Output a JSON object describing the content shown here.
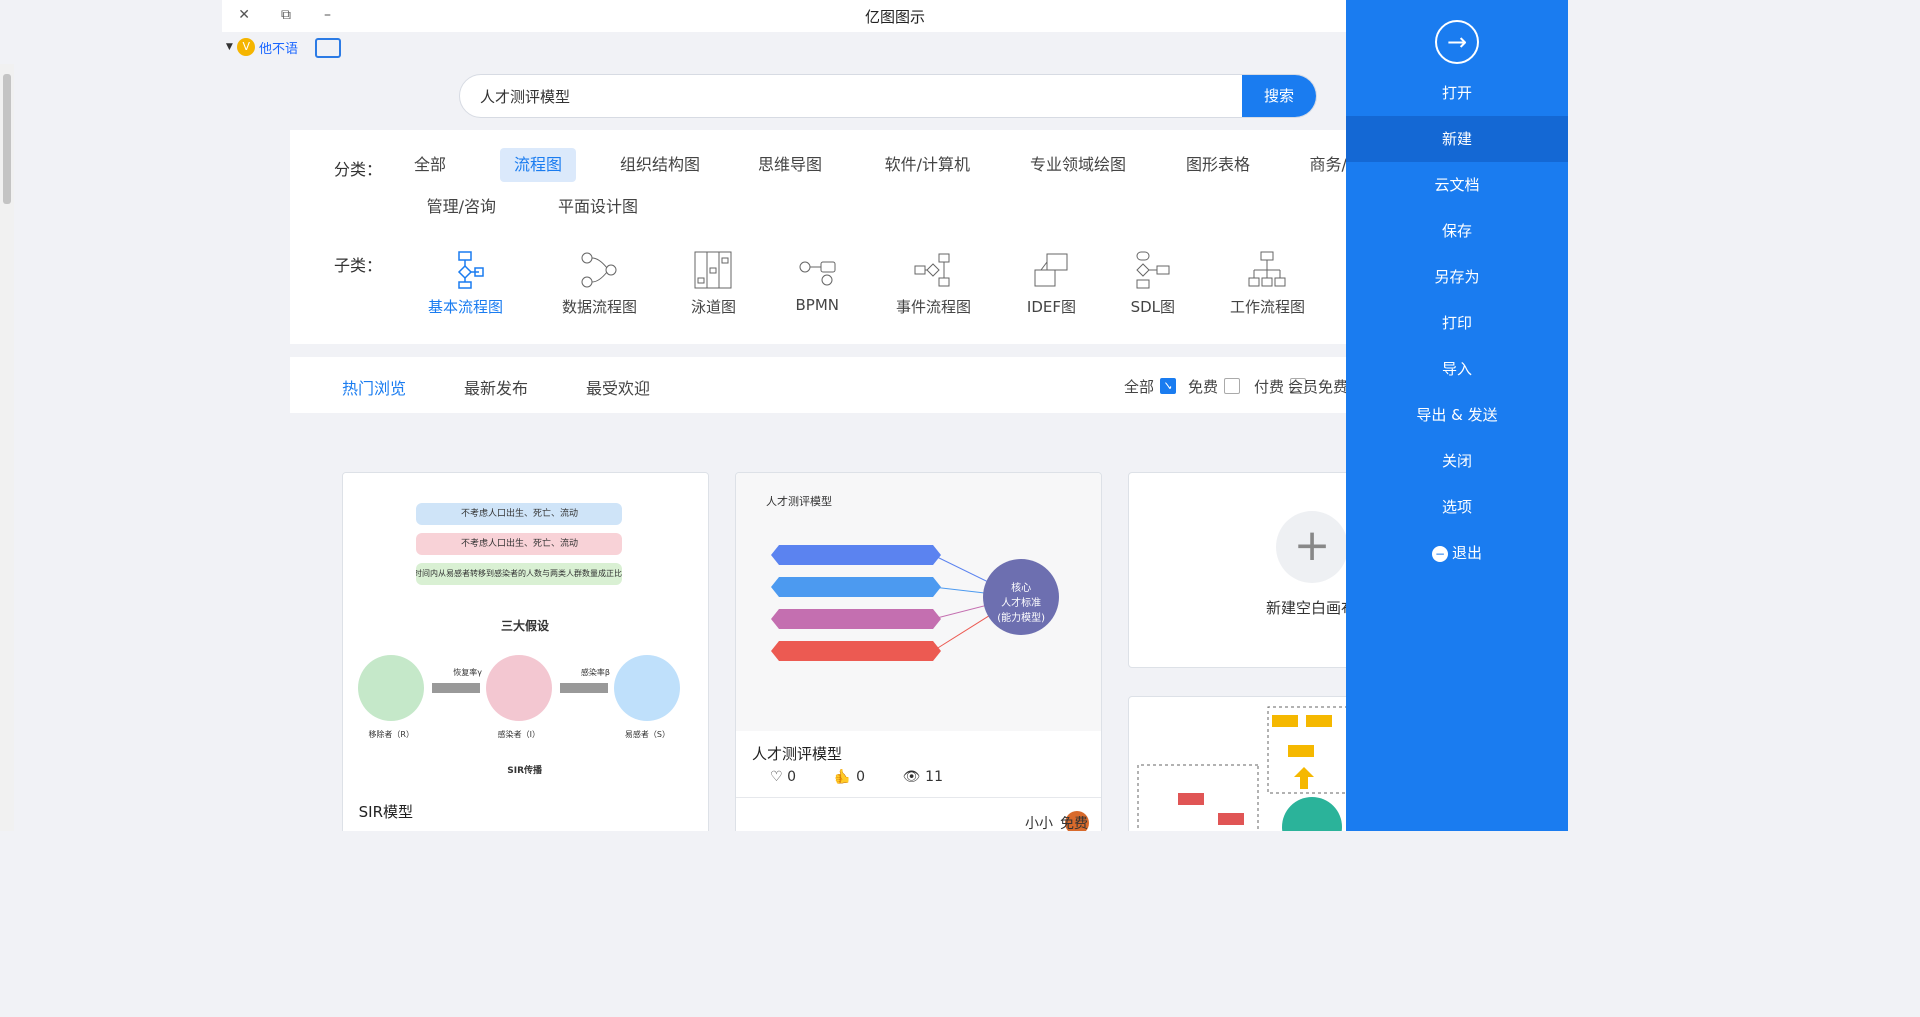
{
  "app": {
    "title": "亿图图示"
  },
  "window": {
    "close": "✕",
    "restore": "⧉",
    "minimize": "–"
  },
  "user": {
    "name": "他不语",
    "crown": "V"
  },
  "sidebar": {
    "items": [
      {
        "label": "打开"
      },
      {
        "label": "新建"
      },
      {
        "label": "云文档"
      },
      {
        "label": "保存"
      },
      {
        "label": "另存为"
      },
      {
        "label": "打印"
      },
      {
        "label": "导入"
      },
      {
        "label": "导出 & 发送"
      },
      {
        "label": "关闭"
      },
      {
        "label": "选项"
      },
      {
        "label": "退出"
      }
    ],
    "active": "新建"
  },
  "search": {
    "button": "搜索",
    "value": "人才测评模型"
  },
  "filter": {
    "category_label": "分类：",
    "categories": [
      "全部",
      "流程图",
      "组织结构图",
      "思维导图",
      "软件/计算机",
      "专业领域绘图",
      "图形表格",
      "商务/PPT",
      "管理/咨询",
      "平面设计图"
    ],
    "active_category": "流程图",
    "sub_label": "子类：",
    "subcategories": [
      "基本流程图",
      "数据流程图",
      "泳道图",
      "BPMN",
      "事件流程图",
      "IDEF图",
      "SDL图",
      "工作流程图"
    ],
    "active_sub": "基本流程图"
  },
  "sort": {
    "options": [
      "热门浏览",
      "最新发布",
      "最受欢迎"
    ],
    "active": "热门浏览"
  },
  "price_filter": [
    {
      "label": "全部",
      "checked": true
    },
    {
      "label": "免费",
      "checked": false
    },
    {
      "label": "付费",
      "checked": false
    },
    {
      "label": "会员免费",
      "checked": false
    }
  ],
  "cards": {
    "new_blank": {
      "label": "新建空白画布",
      "icon": "+"
    },
    "template1": {
      "thumb_title": "人才测评模型",
      "center": "核心\n人才标准\n(能力模型)",
      "title": "人才测评模型",
      "views": "11",
      "likes": "0",
      "favs": "0",
      "author": "小小",
      "price": "免费"
    },
    "template2": {
      "title": "SIR模型",
      "diagram_title": "三大假设",
      "caption": "SIR传播",
      "nodes": [
        "易感者（S）",
        "感染者（I）",
        "移除者（R）"
      ],
      "arrows": [
        "感染率β",
        "恢复率γ"
      ],
      "assumptions": [
        "不考虑人口出生、死亡、流动",
        "不考虑人口出生、死亡、流动",
        "单位时间内从易感者转移到感染者的人数与两类人群数量成正比"
      ]
    }
  },
  "colors": {
    "accent": "#1a7cf0",
    "sidebar": "#1a7cf0"
  }
}
